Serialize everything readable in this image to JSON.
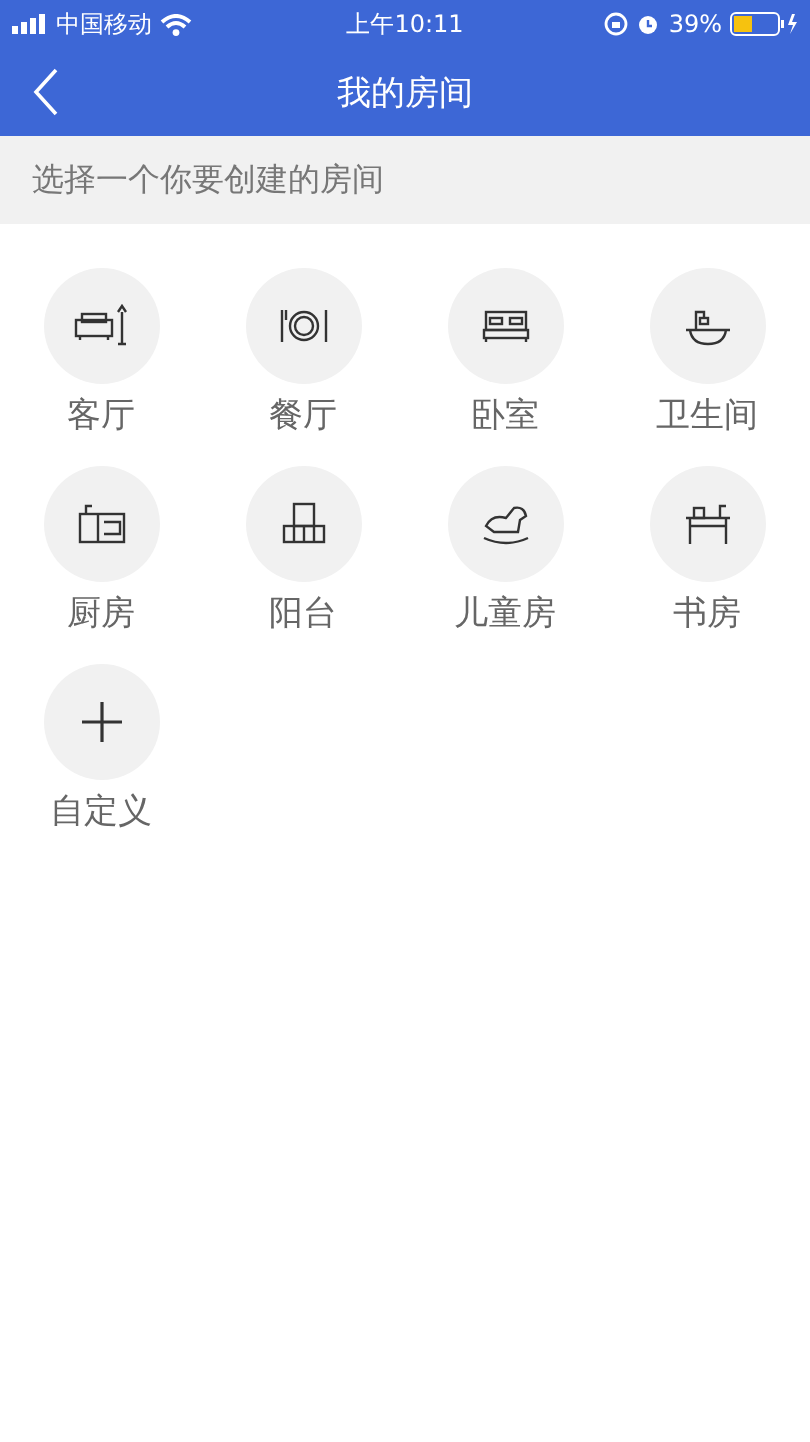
{
  "status_bar": {
    "carrier": "中国移动",
    "time": "上午10:11",
    "battery": "39%"
  },
  "nav": {
    "title": "我的房间"
  },
  "prompt": "选择一个你要创建的房间",
  "rooms": [
    {
      "kind": "sofa",
      "label": "客厅"
    },
    {
      "kind": "dining",
      "label": "餐厅"
    },
    {
      "kind": "bed",
      "label": "卧室"
    },
    {
      "kind": "bath",
      "label": "卫生间"
    },
    {
      "kind": "kitchen",
      "label": "厨房"
    },
    {
      "kind": "balcony",
      "label": "阳台"
    },
    {
      "kind": "horse",
      "label": "儿童房"
    },
    {
      "kind": "desk",
      "label": "书房"
    },
    {
      "kind": "plus",
      "label": "自定义"
    }
  ]
}
